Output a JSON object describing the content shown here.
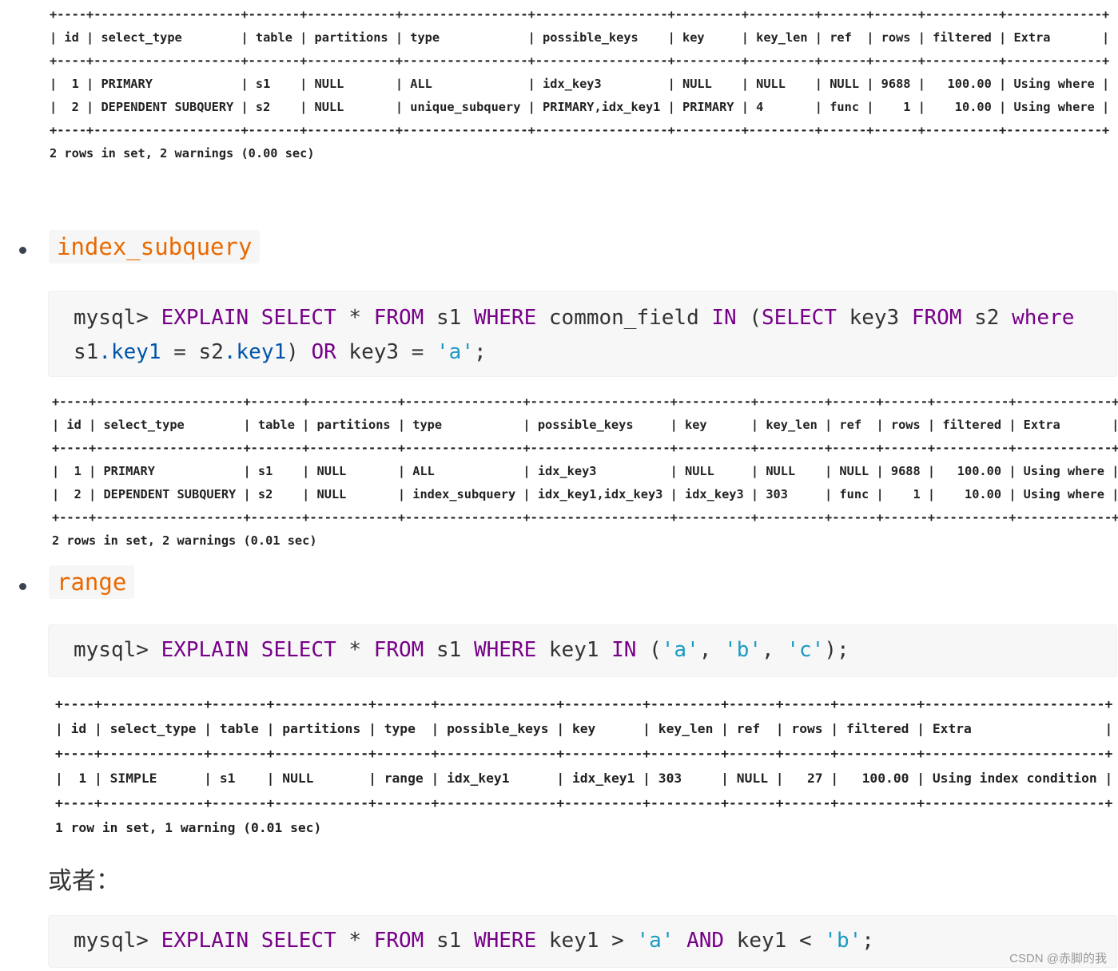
{
  "table1": {
    "lines": [
      "+----+--------------------+-------+------------+-----------------+------------------+---------+---------+------+------+----------+-------------+",
      "| id | select_type        | table | partitions | type            | possible_keys    | key     | key_len | ref  | rows | filtered | Extra       |",
      "+----+--------------------+-------+------------+-----------------+------------------+---------+---------+------+------+----------+-------------+",
      "|  1 | PRIMARY            | s1    | NULL       | ALL             | idx_key3         | NULL    | NULL    | NULL | 9688 |   100.00 | Using where |",
      "|  2 | DEPENDENT SUBQUERY | s2    | NULL       | unique_subquery | PRIMARY,idx_key1 | PRIMARY | 4       | func |    1 |    10.00 | Using where |",
      "+----+--------------------+-------+------------+-----------------+------------------+---------+---------+------+------+----------+-------------+",
      "2 rows in set, 2 warnings (0.00 sec)"
    ]
  },
  "section1": {
    "label": "index_subquery"
  },
  "code1": {
    "line1": [
      [
        "mysql> ",
        "p"
      ],
      [
        "EXPLAIN SELECT",
        "k"
      ],
      [
        " * ",
        "p"
      ],
      [
        "FROM",
        "k"
      ],
      [
        " s1 ",
        "p"
      ],
      [
        "WHERE",
        "k"
      ],
      [
        " common_field ",
        "p"
      ],
      [
        "IN",
        "k"
      ],
      [
        " (",
        "p"
      ],
      [
        "SELECT",
        "k"
      ],
      [
        " key3 ",
        "p"
      ],
      [
        "FROM",
        "k"
      ],
      [
        " s2 ",
        "p"
      ],
      [
        "where",
        "k"
      ]
    ],
    "line2": [
      [
        "s1",
        "p"
      ],
      [
        ".key1",
        "v"
      ],
      [
        " = s2",
        "p"
      ],
      [
        ".key1",
        "v"
      ],
      [
        ") ",
        "p"
      ],
      [
        "OR",
        "k"
      ],
      [
        " key3 = ",
        "p"
      ],
      [
        "'a'",
        "s"
      ],
      [
        ";",
        "p"
      ]
    ]
  },
  "table2": {
    "lines": [
      "+----+--------------------+-------+------------+----------------+-------------------+----------+---------+------+------+----------+-------------+",
      "| id | select_type        | table | partitions | type           | possible_keys     | key      | key_len | ref  | rows | filtered | Extra       |",
      "+----+--------------------+-------+------------+----------------+-------------------+----------+---------+------+------+----------+-------------+",
      "|  1 | PRIMARY            | s1    | NULL       | ALL            | idx_key3          | NULL     | NULL    | NULL | 9688 |   100.00 | Using where |",
      "|  2 | DEPENDENT SUBQUERY | s2    | NULL       | index_subquery | idx_key1,idx_key3 | idx_key3 | 303     | func |    1 |    10.00 | Using where |",
      "+----+--------------------+-------+------------+----------------+-------------------+----------+---------+------+------+----------+-------------+",
      "2 rows in set, 2 warnings (0.01 sec)"
    ]
  },
  "section2": {
    "label": "range"
  },
  "code2": {
    "line1": [
      [
        "mysql> ",
        "p"
      ],
      [
        "EXPLAIN SELECT",
        "k"
      ],
      [
        " * ",
        "p"
      ],
      [
        "FROM",
        "k"
      ],
      [
        " s1 ",
        "p"
      ],
      [
        "WHERE",
        "k"
      ],
      [
        " key1 ",
        "p"
      ],
      [
        "IN",
        "k"
      ],
      [
        " (",
        "p"
      ],
      [
        "'a'",
        "s"
      ],
      [
        ", ",
        "p"
      ],
      [
        "'b'",
        "s"
      ],
      [
        ", ",
        "p"
      ],
      [
        "'c'",
        "s"
      ],
      [
        ");",
        "p"
      ]
    ]
  },
  "table3": {
    "lines": [
      "+----+-------------+-------+------------+-------+---------------+----------+---------+------+------+----------+-----------------------+",
      "| id | select_type | table | partitions | type  | possible_keys | key      | key_len | ref  | rows | filtered | Extra                 |",
      "+----+-------------+-------+------------+-------+---------------+----------+---------+------+------+----------+-----------------------+",
      "|  1 | SIMPLE      | s1    | NULL       | range | idx_key1      | idx_key1 | 303     | NULL |   27 |   100.00 | Using index condition |",
      "+----+-------------+-------+------------+-------+---------------+----------+---------+------+------+----------+-----------------------+",
      "1 row in set, 1 warning (0.01 sec)"
    ]
  },
  "or_text": "或者：",
  "code3": {
    "line1": [
      [
        "mysql> ",
        "p"
      ],
      [
        "EXPLAIN SELECT",
        "k"
      ],
      [
        " * ",
        "p"
      ],
      [
        "FROM",
        "k"
      ],
      [
        " s1 ",
        "p"
      ],
      [
        "WHERE",
        "k"
      ],
      [
        " key1 > ",
        "p"
      ],
      [
        "'a'",
        "s"
      ],
      [
        " ",
        "p"
      ],
      [
        "AND",
        "k"
      ],
      [
        " key1 < ",
        "p"
      ],
      [
        "'b'",
        "s"
      ],
      [
        ";",
        "p"
      ]
    ]
  },
  "watermark": "CSDN @赤脚的我"
}
